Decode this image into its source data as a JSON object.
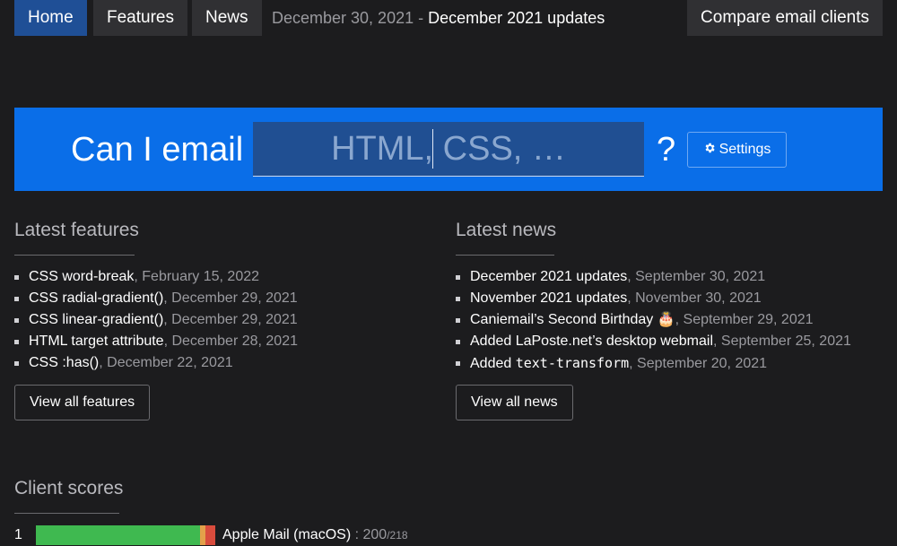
{
  "nav": {
    "home": "Home",
    "features": "Features",
    "news": "News",
    "compare": "Compare email clients"
  },
  "breadcrumb": {
    "date": "December 30, 2021",
    "separator": "-",
    "title": "December 2021 updates"
  },
  "hero": {
    "title": "Can I email",
    "search_placeholder": "HTML, CSS, …",
    "search_value": "",
    "help": "?",
    "settings_label": "Settings",
    "settings_icon": "gear-icon",
    "background_color": "#0a6ee8"
  },
  "latest_features": {
    "title": "Latest features",
    "items": [
      {
        "name": "CSS word-break",
        "date": "February 15, 2022"
      },
      {
        "name": "CSS radial-gradient()",
        "date": "December 29, 2021"
      },
      {
        "name": "CSS linear-gradient()",
        "date": "December 29, 2021"
      },
      {
        "name": "HTML target attribute",
        "date": "December 28, 2021"
      },
      {
        "name": "CSS :has()",
        "date": "December 22, 2021"
      }
    ],
    "view_all": "View all features"
  },
  "latest_news": {
    "title": "Latest news",
    "items": [
      {
        "name": "December 2021 updates",
        "date": "September 30, 2021"
      },
      {
        "name": "November 2021 updates",
        "date": "November 30, 2021"
      },
      {
        "name": "Caniemail’s Second Birthday 🎂",
        "date": "September 29, 2021"
      },
      {
        "name": "Added LaPoste.net’s desktop webmail",
        "date": "September 25, 2021"
      },
      {
        "name_prefix": "Added",
        "name_code": "text-transform",
        "date": "September 20, 2021"
      }
    ],
    "view_all": "View all news"
  },
  "client_scores": {
    "title": "Client scores",
    "rows": [
      {
        "rank": "1",
        "name": "Apple Mail (macOS)",
        "score": "200",
        "total": "/218",
        "supported_fraction": 0.917,
        "partial_fraction": 0.028,
        "unsupported_fraction": 0.055
      }
    ],
    "colors": {
      "supported": "#3fb950",
      "partial": "#e3a04a",
      "unsupported": "#d94c3d"
    }
  }
}
